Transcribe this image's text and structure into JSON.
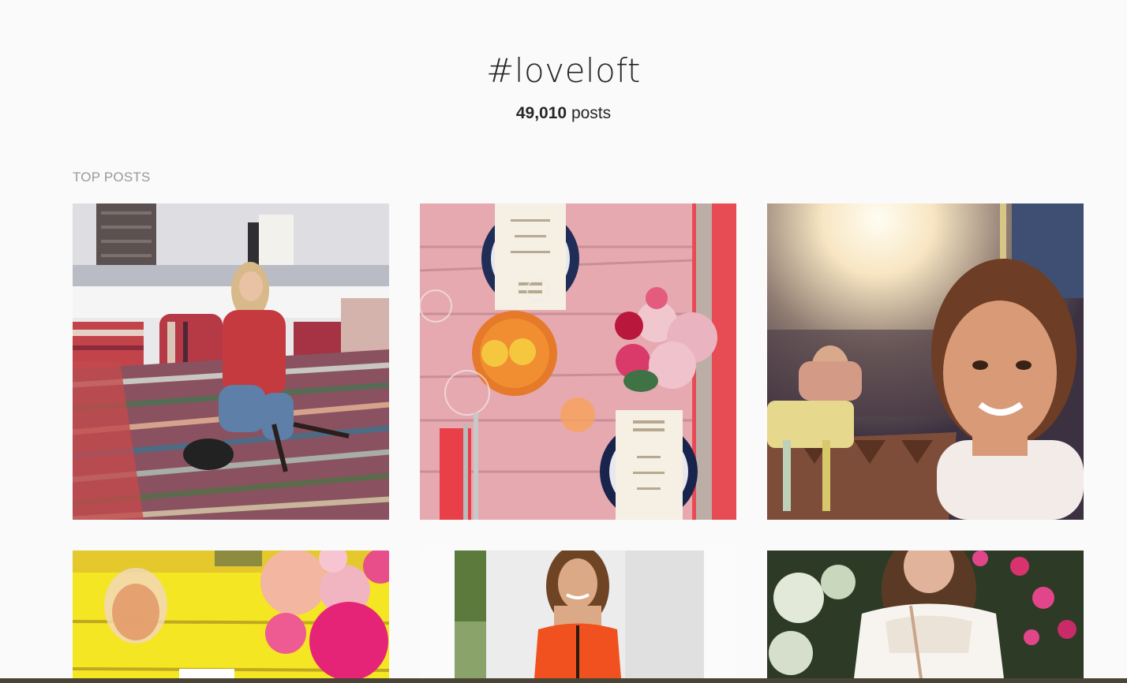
{
  "hashtag": {
    "title": "#loveloft",
    "count": "49,010",
    "count_unit": "posts"
  },
  "sections": {
    "top_posts_label": "TOP POSTS"
  },
  "posts": [
    {
      "image": "rooftop-striped-cushions"
    },
    {
      "image": "pink-table-setting"
    },
    {
      "image": "sunset-selfie"
    },
    {
      "image": "yellow-table-roses"
    },
    {
      "image": "woman-orange-top"
    },
    {
      "image": "woman-white-lace-top"
    }
  ],
  "colors": {
    "background": "#fafafa",
    "text": "#262626",
    "muted": "#999999"
  }
}
